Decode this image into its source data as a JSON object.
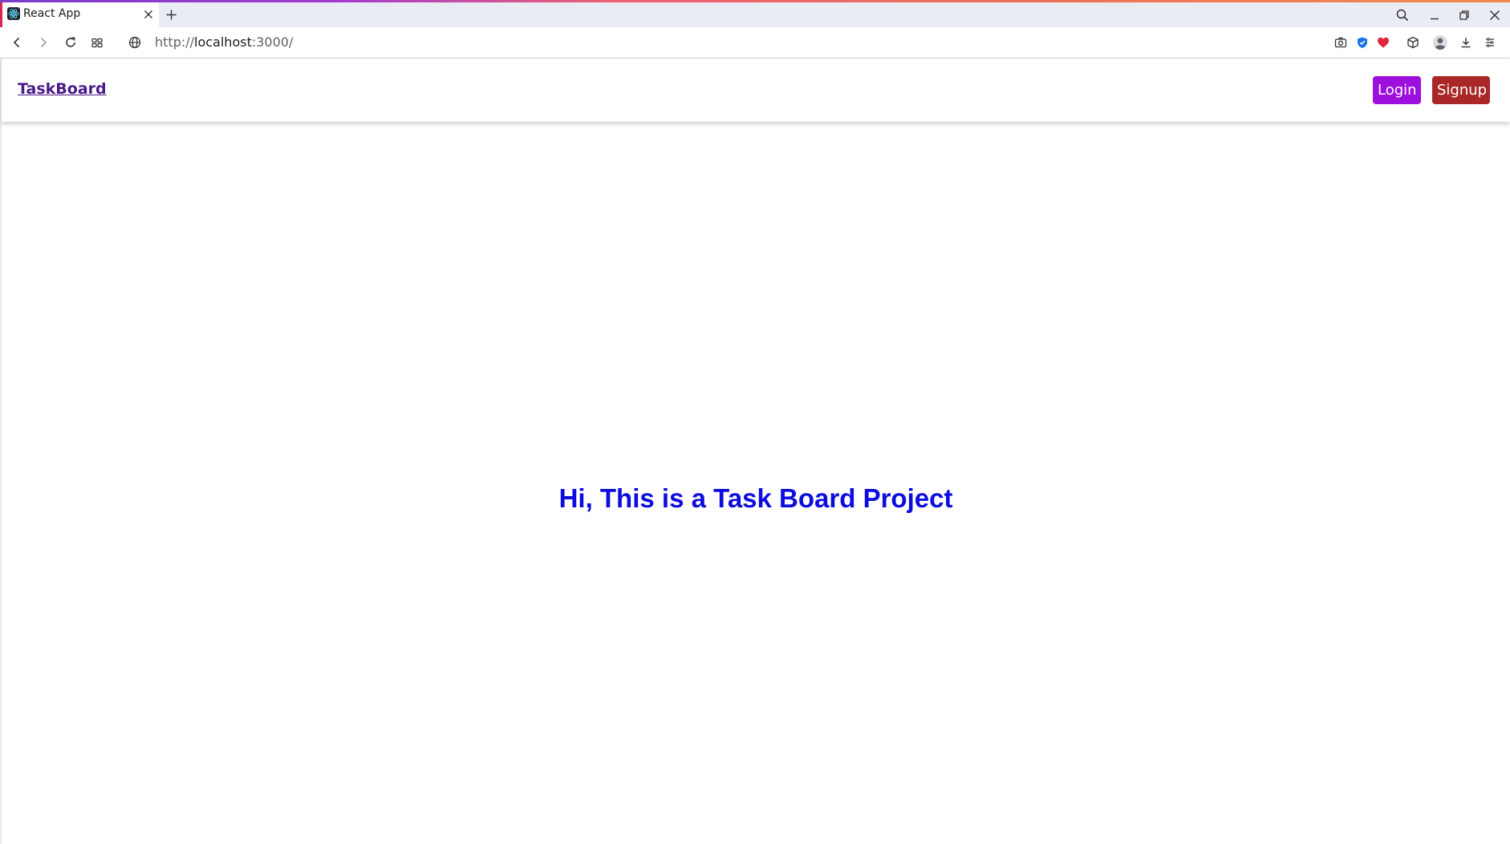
{
  "browser": {
    "tab": {
      "title": "React App",
      "favicon": "react-logo-icon"
    },
    "new_tab_icon": "plus-icon",
    "window_controls": [
      "search-icon",
      "minimize-icon",
      "restore-icon",
      "close-icon"
    ],
    "address_bar": {
      "scheme": "http://",
      "host": "localhost",
      "port": ":3000/"
    },
    "toolbar_icons": [
      "back-icon",
      "forward-icon",
      "reload-icon",
      "tab-grid-icon",
      "globe-icon",
      "camera-icon",
      "shield-icon",
      "heart-icon",
      "cube-icon",
      "profile-icon",
      "download-icon",
      "menu-icon"
    ]
  },
  "page": {
    "navbar": {
      "brand": "TaskBoard",
      "login_label": "Login",
      "signup_label": "Signup"
    },
    "hero_text": "Hi, This is a Task Board Project"
  },
  "colors": {
    "brand": "#4b1a8a",
    "login_button": "#9d0fdc",
    "signup_button": "#a92727",
    "hero_text": "#0c0ce0"
  }
}
